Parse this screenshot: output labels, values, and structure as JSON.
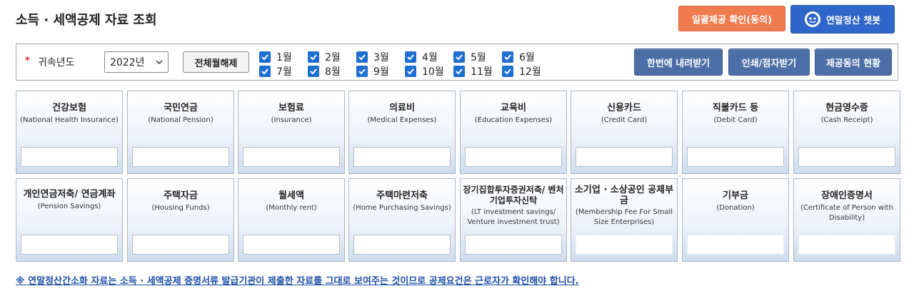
{
  "page": {
    "title": "소득 · 세액공제 자료 조회",
    "bulk_consent_label": "일괄제공 확인(동의)",
    "chatbot_label": "연말정산 챗봇"
  },
  "filter": {
    "required_mark": "*",
    "year_label": "귀속년도",
    "year_value": "2022년",
    "clear_all_label": "전체월해제",
    "months": [
      "1월",
      "2월",
      "3월",
      "4월",
      "5월",
      "6월",
      "7월",
      "8월",
      "9월",
      "10월",
      "11월",
      "12월"
    ],
    "download_all_label": "한번에 내려받기",
    "print_label": "인쇄/점자받기",
    "consent_status_label": "제공동의 현황"
  },
  "cards_row1": [
    {
      "name": "건강보험",
      "eng": "(National Health Insurance)"
    },
    {
      "name": "국민연금",
      "eng": "(National Pension)"
    },
    {
      "name": "보험료",
      "eng": "(Insurance)"
    },
    {
      "name": "의료비",
      "eng": "(Medical Expenses)"
    },
    {
      "name": "교육비",
      "eng": "(Education Expenses)"
    },
    {
      "name": "신용카드",
      "eng": "(Credit Card)"
    },
    {
      "name": "직불카드 등",
      "eng": "(Debit Card)"
    },
    {
      "name": "현금영수증",
      "eng": "(Cash Receipt)"
    }
  ],
  "cards_row2": [
    {
      "name": "개인연금저축/ 연금계좌",
      "eng": "(Pension Savings)"
    },
    {
      "name": "주택자금",
      "eng": "(Housing Funds)"
    },
    {
      "name": "월세액",
      "eng": "(Monthly rent)"
    },
    {
      "name": "주택마련저축",
      "eng": "(Home Purchasing Savings)"
    },
    {
      "name": "장기집합투자증권저축/ 벤처기업투자신탁",
      "eng": "(LT investment savings/ Venture investment trust)"
    },
    {
      "name": "소기업 · 소상공인 공제부금",
      "eng": "(Membership Fee For Small Size Enterprises)"
    },
    {
      "name": "기부금",
      "eng": "(Donation)"
    },
    {
      "name": "장애인증명서",
      "eng": "(Certificate of Person with Disability)"
    }
  ],
  "notice": "※ 연말정산간소화 자료는 소득 · 세액공제 증명서류 발급기관이 제출한 자료를 그대로 보여주는 것이므로 공제요건은 근로자가 확인해야 합니다.",
  "colors": {
    "orange": "#ef7b4f",
    "chatbot_blue": "#2f66c9",
    "action_blue": "#4b6fa6",
    "checkbox_blue": "#1f6fd1",
    "notice_blue": "#1d4fa8"
  }
}
